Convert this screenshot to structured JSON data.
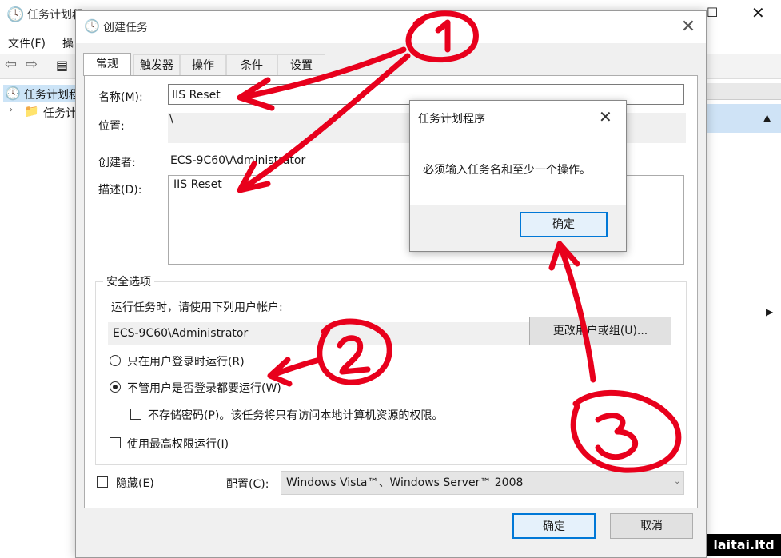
{
  "background_window": {
    "title": "任务计划程",
    "menu": [
      "文件(F)",
      "操"
    ],
    "tree_root": "任务计划程",
    "tree_child": "任务计"
  },
  "dialog": {
    "title": "创建任务",
    "tabs": [
      "常规",
      "触发器",
      "操作",
      "条件",
      "设置"
    ],
    "active_tab": "常规",
    "name_label": "名称(M):",
    "name_value": "IIS Reset",
    "location_label": "位置:",
    "location_value": "\\",
    "author_label": "创建者:",
    "author_value": "ECS-9C60\\Administrator",
    "description_label": "描述(D):",
    "description_value": "IIS Reset",
    "security": {
      "group_title": "安全选项",
      "run_as_prompt": "运行任务时，请使用下列用户帐户:",
      "account_value": "ECS-9C60\\Administrator",
      "change_user_button": "更改用户或组(U)...",
      "radio_logged_on": "只在用户登录时运行(R)",
      "radio_whether_logged": "不管用户是否登录都要运行(W)",
      "radio_selected": "whether_logged",
      "no_store_password": "不存储密码(P)。该任务将只有访问本地计算机资源的权限。",
      "highest_privileges": "使用最高权限运行(I)"
    },
    "hidden_label": "隐藏(E)",
    "config_label": "配置(C):",
    "config_value": "Windows Vista™、Windows Server™ 2008",
    "ok_button": "确定",
    "cancel_button": "取消"
  },
  "message_box": {
    "title": "任务计划程序",
    "text": "必须输入任务名和至少一个操作。",
    "ok_button": "确定"
  },
  "watermark": "laitai.ltd",
  "annotation_color": "#e8001c"
}
